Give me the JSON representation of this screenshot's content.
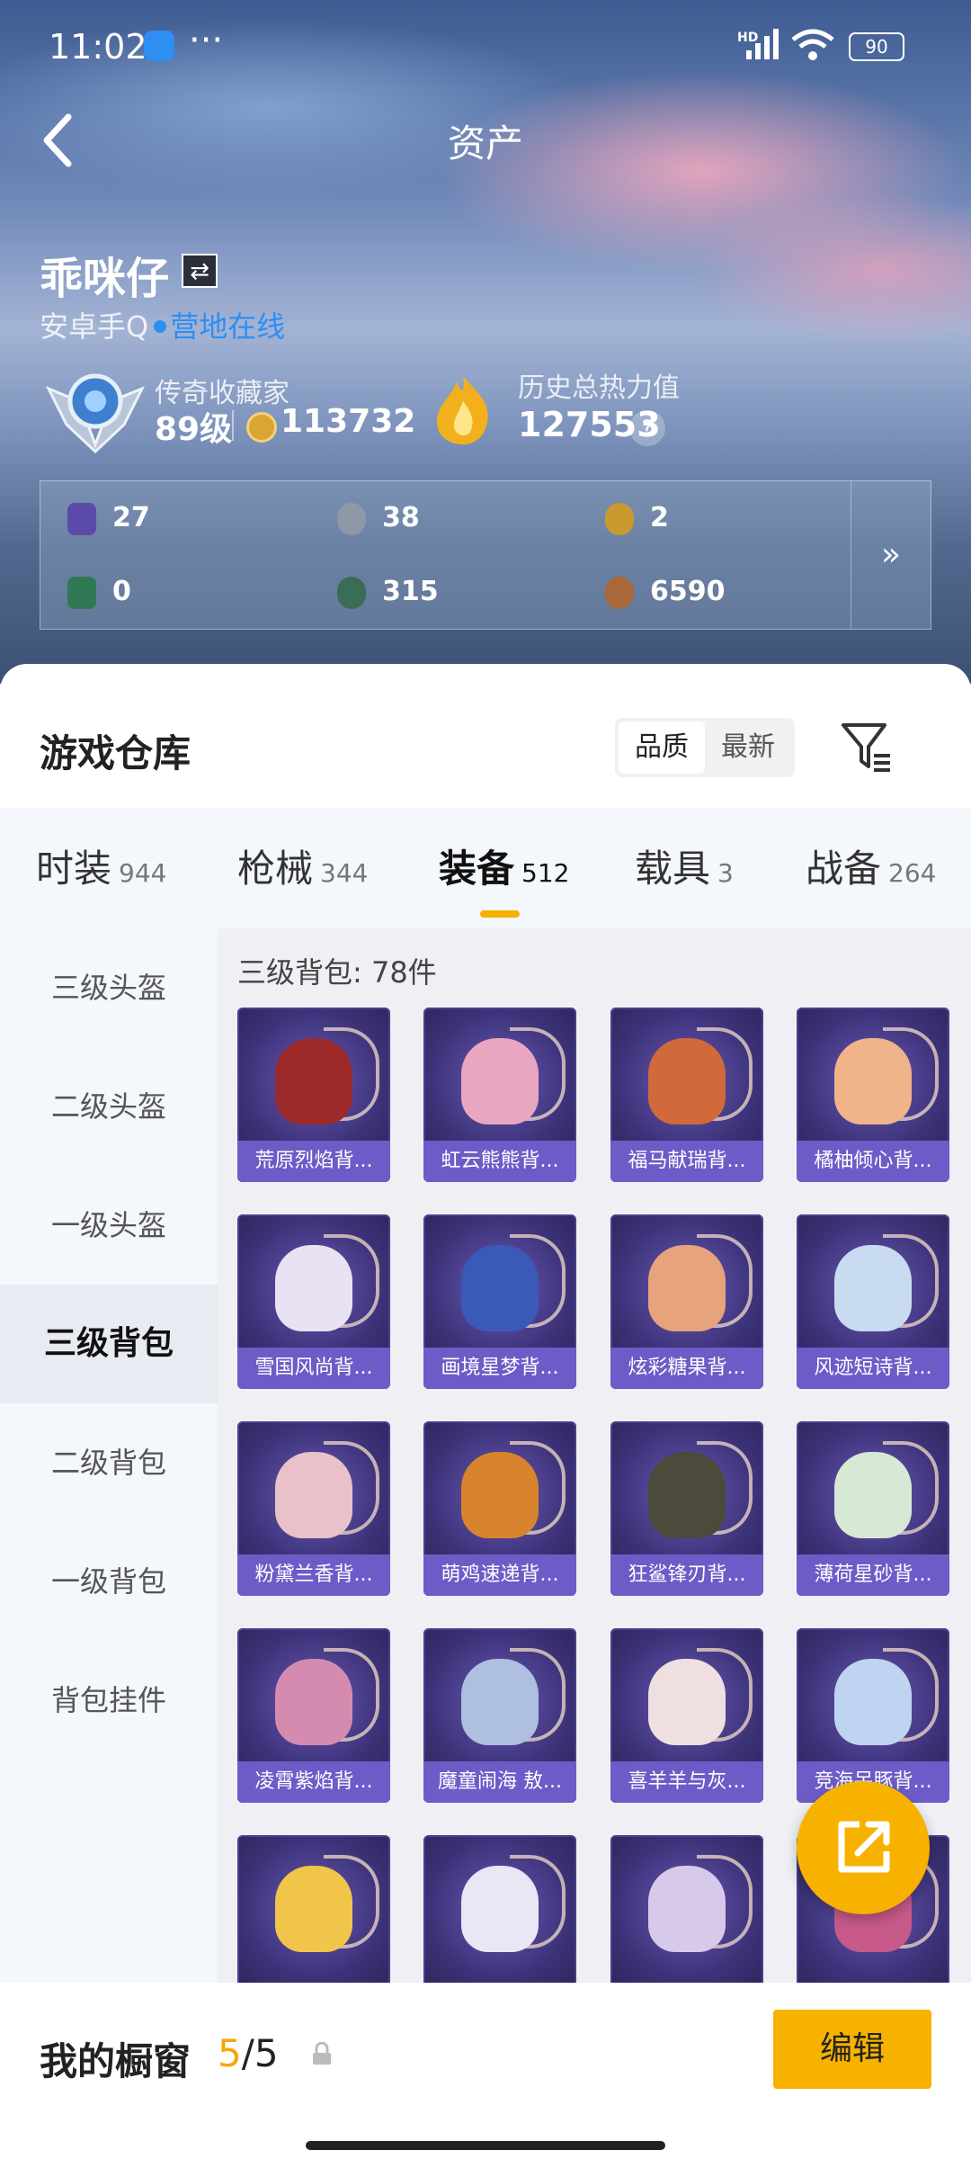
{
  "status_bar": {
    "time": "11:02",
    "battery": "90",
    "network": "HD"
  },
  "header": {
    "title": "资产"
  },
  "profile": {
    "name": "乖咪仔",
    "server": "安卓手Q",
    "status": "营地在线",
    "collector_title": "传奇收藏家",
    "level": "89级",
    "coins": "113732",
    "heat_label": "历史总热力值",
    "heat_value": "127553",
    "help": "?"
  },
  "stats": [
    {
      "icon": "purple-card-icon",
      "value": "27",
      "color": "#5b4aa8"
    },
    {
      "icon": "silver-coin-icon",
      "value": "38",
      "color": "#8e98a6"
    },
    {
      "icon": "gold-coin-icon",
      "value": "2",
      "color": "#c99a2e"
    },
    {
      "icon": "green-card-icon",
      "value": "0",
      "color": "#2f7a55"
    },
    {
      "icon": "green-orb-icon",
      "value": "315",
      "color": "#3a6c56"
    },
    {
      "icon": "bronze-coin-icon",
      "value": "6590",
      "color": "#a9683a"
    }
  ],
  "stats_more": "»",
  "warehouse": {
    "title": "游戏仓库",
    "sort": [
      "品质",
      "最新"
    ],
    "tabs": [
      {
        "label": "时装",
        "count": "944"
      },
      {
        "label": "枪械",
        "count": "344"
      },
      {
        "label": "装备",
        "count": "512"
      },
      {
        "label": "载具",
        "count": "3"
      },
      {
        "label": "战备",
        "count": "264"
      }
    ],
    "categories": [
      "三级头盔",
      "二级头盔",
      "一级头盔",
      "三级背包",
      "二级背包",
      "一级背包",
      "背包挂件"
    ],
    "section_title": "三级背包: 78件",
    "items": [
      {
        "name": "荒原烈焰背...",
        "color": "#9c2a2a"
      },
      {
        "name": "虹云熊熊背...",
        "color": "#e9a6c1"
      },
      {
        "name": "福马献瑞背...",
        "color": "#d06a3a"
      },
      {
        "name": "橘柚倾心背...",
        "color": "#f0b38a"
      },
      {
        "name": "雪国风尚背...",
        "color": "#e8e2f3"
      },
      {
        "name": "画境星梦背...",
        "color": "#3b5ab8"
      },
      {
        "name": "炫彩糖果背...",
        "color": "#e7a37c"
      },
      {
        "name": "风迹短诗背...",
        "color": "#c9dbf0"
      },
      {
        "name": "粉黛兰香背...",
        "color": "#e8c2c8"
      },
      {
        "name": "萌鸡速递背...",
        "color": "#d8842c"
      },
      {
        "name": "狂鲨锋刃背...",
        "color": "#4c4a3a"
      },
      {
        "name": "薄荷星砂背...",
        "color": "#d7e9d4"
      },
      {
        "name": "凌霄紫焰背...",
        "color": "#d58bb0"
      },
      {
        "name": "魔童闹海 敖...",
        "color": "#aebfe0"
      },
      {
        "name": "喜羊羊与灰...",
        "color": "#f0dfe0"
      },
      {
        "name": "竞海呆豚背...",
        "color": "#bfd4f0"
      },
      {
        "name": "",
        "color": "#f0c54a"
      },
      {
        "name": "",
        "color": "#e9e6f5"
      },
      {
        "name": "",
        "color": "#d7c9ea"
      },
      {
        "name": "",
        "color": "#c85a8a"
      }
    ]
  },
  "showcase": {
    "label": "我的橱窗",
    "current": "5",
    "total": "/5",
    "edit": "编辑"
  }
}
